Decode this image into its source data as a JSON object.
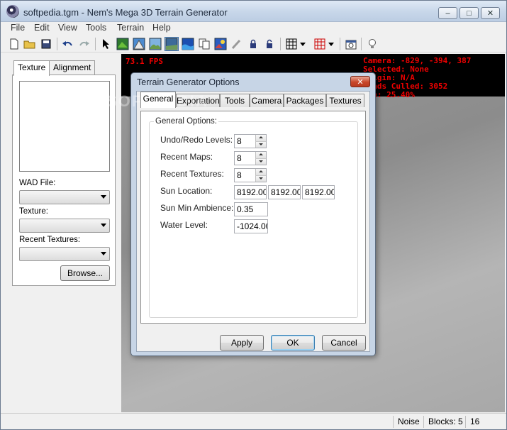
{
  "window": {
    "title": "softpedia.tgm - Nem's Mega 3D Terrain Generator",
    "controls": {
      "minimize": "–",
      "maximize": "□",
      "close": "✕"
    }
  },
  "menu": [
    "File",
    "Edit",
    "View",
    "Tools",
    "Terrain",
    "Help"
  ],
  "toolbar": {
    "icons": [
      "new-file-icon",
      "open-folder-icon",
      "save-icon",
      "undo-icon",
      "redo-icon",
      "select-arrow-icon",
      "terrain-grass-icon",
      "terrain-mountain-icon",
      "terrain-hills-icon",
      "terrain-flat-icon",
      "terrain-water-icon",
      "copy-icon",
      "terrain-sky-icon",
      "paint-brush-icon",
      "lock-icon",
      "unlock-icon",
      "grid-icon",
      "grid-dropdown-icon",
      "red-grid-icon",
      "red-grid-dropdown-icon",
      "options-icon",
      "lightbulb-icon"
    ]
  },
  "left_panel": {
    "tabs": [
      "Texture",
      "Alignment"
    ],
    "wad_file_label": "WAD File:",
    "texture_label": "Texture:",
    "recent_textures_label": "Recent Textures:",
    "browse_button": "Browse..."
  },
  "viewport": {
    "fps": "73.1 FPS",
    "info": "Camera: -829, -394, 387\nSelected: None\n  igin: N/A\n  ads Culled: 3052\nawn: 25.40%"
  },
  "dialog": {
    "title": "Terrain Generator Options",
    "close": "✕",
    "tabs": [
      "General",
      "Exportation",
      "Tools",
      "Camera",
      "Packages",
      "Textures"
    ],
    "group_title": "General Options:",
    "fields": {
      "undo_redo_label": "Undo/Redo Levels:",
      "undo_redo_value": "8",
      "recent_maps_label": "Recent Maps:",
      "recent_maps_value": "8",
      "recent_textures_label": "Recent Textures:",
      "recent_textures_value": "8",
      "sun_location_label": "Sun Location:",
      "sun_x": "8192.00",
      "sun_y": "8192.00",
      "sun_z": "8192.00",
      "sun_min_ambience_label": "Sun Min Ambience:",
      "sun_min_ambience_value": "0.35",
      "water_level_label": "Water Level:",
      "water_level_value": "-1024.00"
    },
    "buttons": {
      "apply": "Apply",
      "ok": "OK",
      "cancel": "Cancel"
    }
  },
  "statusbar": {
    "mode": "Noise",
    "blocks": "Blocks: 5",
    "count": "16"
  },
  "watermark": "SOFTPEDIA"
}
